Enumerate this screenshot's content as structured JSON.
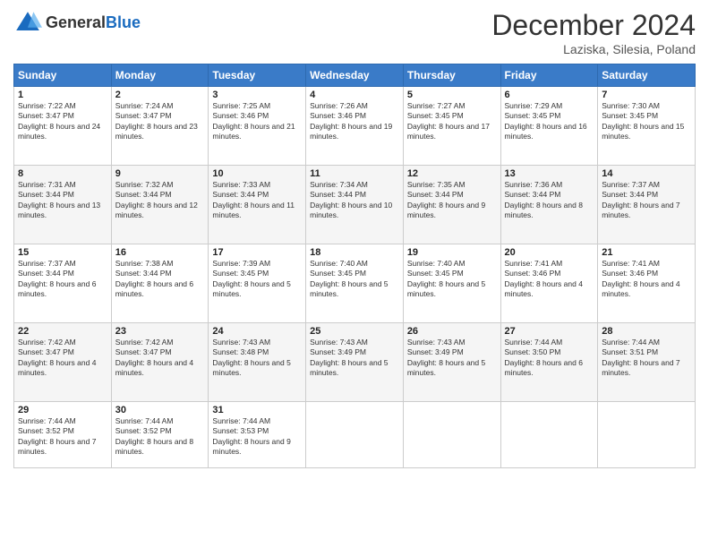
{
  "header": {
    "logo_line1": "General",
    "logo_line2": "Blue",
    "month": "December 2024",
    "location": "Laziska, Silesia, Poland"
  },
  "days_of_week": [
    "Sunday",
    "Monday",
    "Tuesday",
    "Wednesday",
    "Thursday",
    "Friday",
    "Saturday"
  ],
  "weeks": [
    [
      {
        "day": "1",
        "sunrise": "7:22 AM",
        "sunset": "3:47 PM",
        "daylight": "8 hours and 24 minutes."
      },
      {
        "day": "2",
        "sunrise": "7:24 AM",
        "sunset": "3:47 PM",
        "daylight": "8 hours and 23 minutes."
      },
      {
        "day": "3",
        "sunrise": "7:25 AM",
        "sunset": "3:46 PM",
        "daylight": "8 hours and 21 minutes."
      },
      {
        "day": "4",
        "sunrise": "7:26 AM",
        "sunset": "3:46 PM",
        "daylight": "8 hours and 19 minutes."
      },
      {
        "day": "5",
        "sunrise": "7:27 AM",
        "sunset": "3:45 PM",
        "daylight": "8 hours and 17 minutes."
      },
      {
        "day": "6",
        "sunrise": "7:29 AM",
        "sunset": "3:45 PM",
        "daylight": "8 hours and 16 minutes."
      },
      {
        "day": "7",
        "sunrise": "7:30 AM",
        "sunset": "3:45 PM",
        "daylight": "8 hours and 15 minutes."
      }
    ],
    [
      {
        "day": "8",
        "sunrise": "7:31 AM",
        "sunset": "3:44 PM",
        "daylight": "8 hours and 13 minutes."
      },
      {
        "day": "9",
        "sunrise": "7:32 AM",
        "sunset": "3:44 PM",
        "daylight": "8 hours and 12 minutes."
      },
      {
        "day": "10",
        "sunrise": "7:33 AM",
        "sunset": "3:44 PM",
        "daylight": "8 hours and 11 minutes."
      },
      {
        "day": "11",
        "sunrise": "7:34 AM",
        "sunset": "3:44 PM",
        "daylight": "8 hours and 10 minutes."
      },
      {
        "day": "12",
        "sunrise": "7:35 AM",
        "sunset": "3:44 PM",
        "daylight": "8 hours and 9 minutes."
      },
      {
        "day": "13",
        "sunrise": "7:36 AM",
        "sunset": "3:44 PM",
        "daylight": "8 hours and 8 minutes."
      },
      {
        "day": "14",
        "sunrise": "7:37 AM",
        "sunset": "3:44 PM",
        "daylight": "8 hours and 7 minutes."
      }
    ],
    [
      {
        "day": "15",
        "sunrise": "7:37 AM",
        "sunset": "3:44 PM",
        "daylight": "8 hours and 6 minutes."
      },
      {
        "day": "16",
        "sunrise": "7:38 AM",
        "sunset": "3:44 PM",
        "daylight": "8 hours and 6 minutes."
      },
      {
        "day": "17",
        "sunrise": "7:39 AM",
        "sunset": "3:45 PM",
        "daylight": "8 hours and 5 minutes."
      },
      {
        "day": "18",
        "sunrise": "7:40 AM",
        "sunset": "3:45 PM",
        "daylight": "8 hours and 5 minutes."
      },
      {
        "day": "19",
        "sunrise": "7:40 AM",
        "sunset": "3:45 PM",
        "daylight": "8 hours and 5 minutes."
      },
      {
        "day": "20",
        "sunrise": "7:41 AM",
        "sunset": "3:46 PM",
        "daylight": "8 hours and 4 minutes."
      },
      {
        "day": "21",
        "sunrise": "7:41 AM",
        "sunset": "3:46 PM",
        "daylight": "8 hours and 4 minutes."
      }
    ],
    [
      {
        "day": "22",
        "sunrise": "7:42 AM",
        "sunset": "3:47 PM",
        "daylight": "8 hours and 4 minutes."
      },
      {
        "day": "23",
        "sunrise": "7:42 AM",
        "sunset": "3:47 PM",
        "daylight": "8 hours and 4 minutes."
      },
      {
        "day": "24",
        "sunrise": "7:43 AM",
        "sunset": "3:48 PM",
        "daylight": "8 hours and 5 minutes."
      },
      {
        "day": "25",
        "sunrise": "7:43 AM",
        "sunset": "3:49 PM",
        "daylight": "8 hours and 5 minutes."
      },
      {
        "day": "26",
        "sunrise": "7:43 AM",
        "sunset": "3:49 PM",
        "daylight": "8 hours and 5 minutes."
      },
      {
        "day": "27",
        "sunrise": "7:44 AM",
        "sunset": "3:50 PM",
        "daylight": "8 hours and 6 minutes."
      },
      {
        "day": "28",
        "sunrise": "7:44 AM",
        "sunset": "3:51 PM",
        "daylight": "8 hours and 7 minutes."
      }
    ],
    [
      {
        "day": "29",
        "sunrise": "7:44 AM",
        "sunset": "3:52 PM",
        "daylight": "8 hours and 7 minutes."
      },
      {
        "day": "30",
        "sunrise": "7:44 AM",
        "sunset": "3:52 PM",
        "daylight": "8 hours and 8 minutes."
      },
      {
        "day": "31",
        "sunrise": "7:44 AM",
        "sunset": "3:53 PM",
        "daylight": "8 hours and 9 minutes."
      },
      null,
      null,
      null,
      null
    ]
  ]
}
